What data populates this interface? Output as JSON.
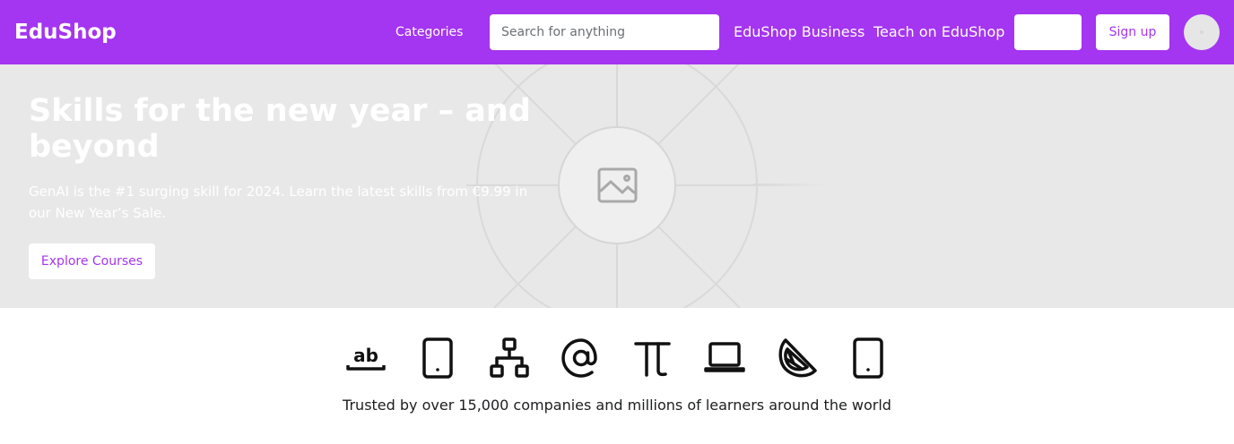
{
  "brand": {
    "name": "EduShop"
  },
  "nav": {
    "categories": "Categories",
    "search_placeholder": "Search for anything",
    "business": "EduShop Business",
    "teach": "Teach on EduShop",
    "login": "",
    "signup": "Sign up"
  },
  "hero": {
    "title": "Skills for the new year – and beyond",
    "subtitle": "GenAI is the #1 surging skill for 2024. Learn the latest skills from €9.99 in our New Year’s Sale.",
    "cta": "Explore Courses",
    "image_icon": "image-placeholder-icon"
  },
  "logos": {
    "icons": [
      "text-ab-icon",
      "mobile-phone-icon",
      "sitemap-icon",
      "at-sign-icon",
      "pi-icon",
      "laptop-icon",
      "lemon-slice-icon",
      "mobile-phone-icon"
    ],
    "caption": "Trusted by over 15,000 companies and millions of learners around the world"
  },
  "colors": {
    "brand": "#a435f0",
    "hero_bg": "#e8e8e8",
    "text": "#1c1d1f"
  }
}
